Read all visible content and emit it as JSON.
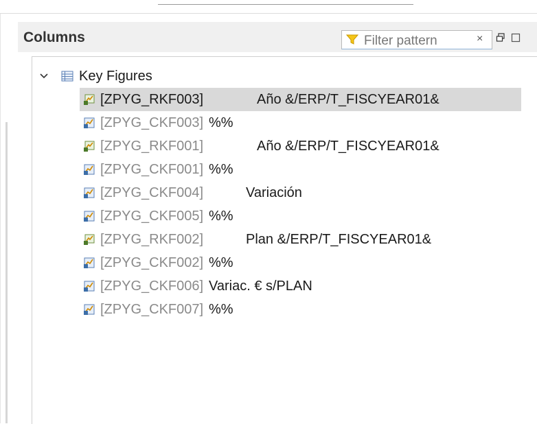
{
  "panel": {
    "title": "Columns",
    "filter_placeholder": "Filter pattern",
    "filter_clear": "×"
  },
  "tree": {
    "root_label": "Key Figures",
    "items": [
      {
        "code": "[ZPYG_RKF003]",
        "desc": "Año &/ERP/T_FISCYEAR01&",
        "type": "restricted",
        "selected": true
      },
      {
        "code": "[ZPYG_CKF003]",
        "desc": "%%",
        "type": "calculated",
        "selected": false
      },
      {
        "code": "[ZPYG_RKF001]",
        "desc": "Año &/ERP/T_FISCYEAR01&",
        "type": "restricted",
        "selected": false
      },
      {
        "code": "[ZPYG_CKF001]",
        "desc": "%%",
        "type": "calculated",
        "selected": false
      },
      {
        "code": "[ZPYG_CKF004]",
        "desc": "Variación",
        "type": "calculated",
        "selected": false
      },
      {
        "code": "[ZPYG_CKF005]",
        "desc": "%%",
        "type": "calculated",
        "selected": false
      },
      {
        "code": "[ZPYG_RKF002]",
        "desc": "Plan &/ERP/T_FISCYEAR01&",
        "type": "restricted",
        "selected": false
      },
      {
        "code": "[ZPYG_CKF002]",
        "desc": "%%",
        "type": "calculated",
        "selected": false
      },
      {
        "code": "[ZPYG_CKF006]",
        "desc": "Variac. € s/PLAN",
        "type": "calculated",
        "selected": false
      },
      {
        "code": "[ZPYG_CKF007]",
        "desc": "%%",
        "type": "calculated",
        "selected": false
      }
    ]
  },
  "icons": {
    "filter": "funnel-icon",
    "restricted": "restricted-key-figure-icon",
    "calculated": "calculated-key-figure-icon",
    "root": "key-figures-table-icon",
    "expand": "chevron-down-icon"
  },
  "colors": {
    "selected_row": "#d9d9d9",
    "header_bg": "#f0f0f0",
    "filter_icon": "#f0b400"
  }
}
